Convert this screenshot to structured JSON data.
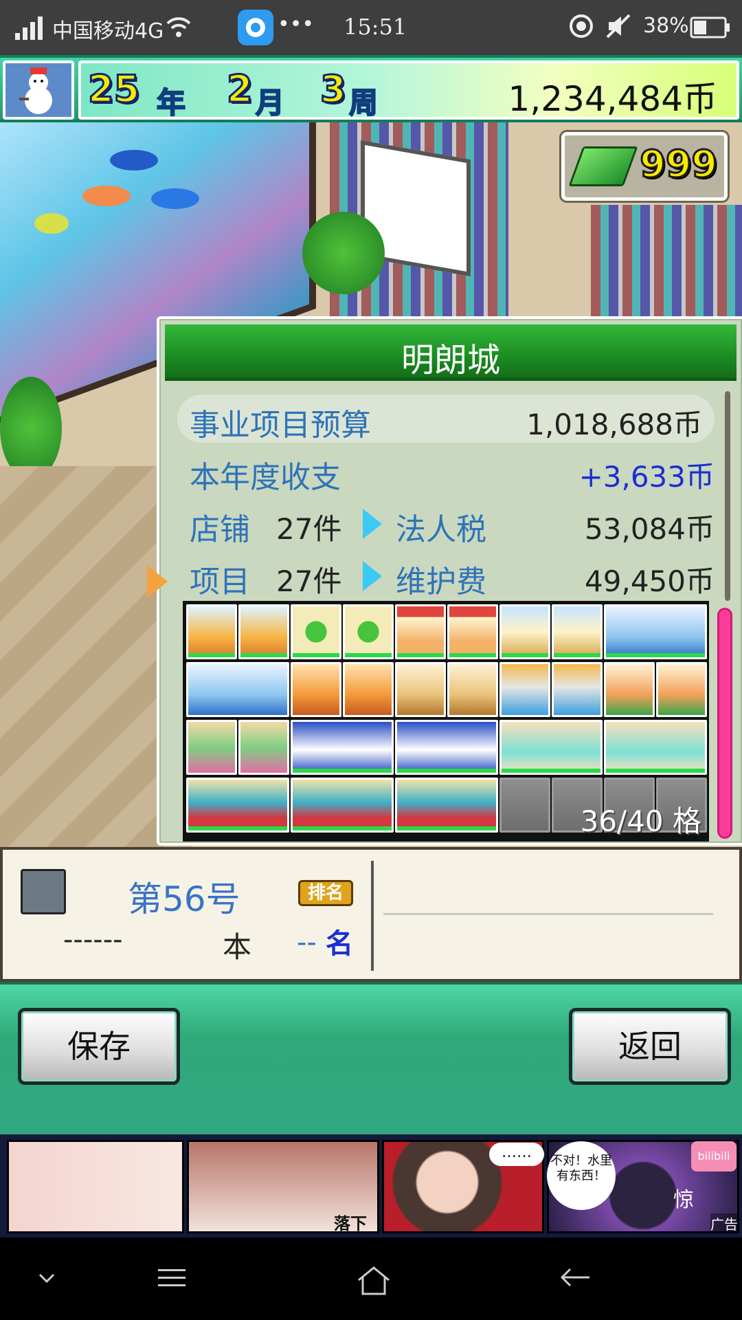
{
  "status_bar": {
    "carrier": "中国移动4G",
    "time": "15:51",
    "battery": "38%",
    "more": "•••"
  },
  "header": {
    "year_num": "25",
    "year_unit": "年",
    "month_num": "2",
    "month_unit": "月",
    "week_num": "3",
    "week_unit": "周",
    "money": "1,234,484币"
  },
  "gem_count": "999",
  "city_panel": {
    "title": "明朗城",
    "budget_label": "事业项目预算",
    "budget_value": "1,018,688币",
    "annual_label": "本年度收支",
    "annual_value": "+3,633币",
    "shops_label": "店铺",
    "shops_count": "27件",
    "tax_label": "法人税",
    "tax_value": "53,084币",
    "projects_label": "项目",
    "projects_count": "27件",
    "maintenance_label": "维护费",
    "maintenance_value": "49,450币",
    "grid_count": "36/40 格"
  },
  "info_panel": {
    "rank_no": "第56号",
    "rank_badge": "排名",
    "dashes": "------",
    "ben": "本",
    "rank_dash": "--",
    "ming": "名"
  },
  "buttons": {
    "save": "保存",
    "back": "返回"
  },
  "ad": {
    "ellipsis": "……",
    "bubble": "不对！水里有东西！",
    "fall": "落下",
    "jing": "惊",
    "tag": "广告",
    "bili": "bilibili"
  },
  "colors": {
    "accent_green": "#1b8c22",
    "label_blue": "#2e73b8",
    "positive_blue": "#1a2fd1",
    "pink_scroll": "#fb3d9a"
  }
}
